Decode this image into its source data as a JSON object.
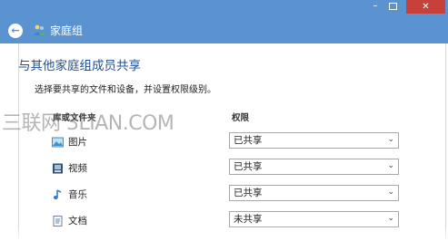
{
  "window": {
    "minimize_glyph": "–",
    "close_glyph": "✕"
  },
  "address": {
    "title": "家庭组",
    "back_icon": "back-arrow-icon",
    "homegroup_icon": "homegroup-icon"
  },
  "main": {
    "heading": "与其他家庭组成员共享",
    "instruction": "选择要共享的文件和设备，并设置权限级别。",
    "col_library": "库或文件夹",
    "col_permission": "权限",
    "watermark": "三联网 3LIAN.COM"
  },
  "rows": [
    {
      "label": "图片",
      "icon": "pictures-icon",
      "value": "已共享"
    },
    {
      "label": "视频",
      "icon": "videos-icon",
      "value": "已共享"
    },
    {
      "label": "音乐",
      "icon": "music-icon",
      "value": "已共享"
    },
    {
      "label": "文档",
      "icon": "documents-icon",
      "value": "未共享"
    }
  ],
  "colors": {
    "titlebar": "#5b93d0",
    "heading": "#1f4f8f",
    "close": "#c8403a"
  }
}
